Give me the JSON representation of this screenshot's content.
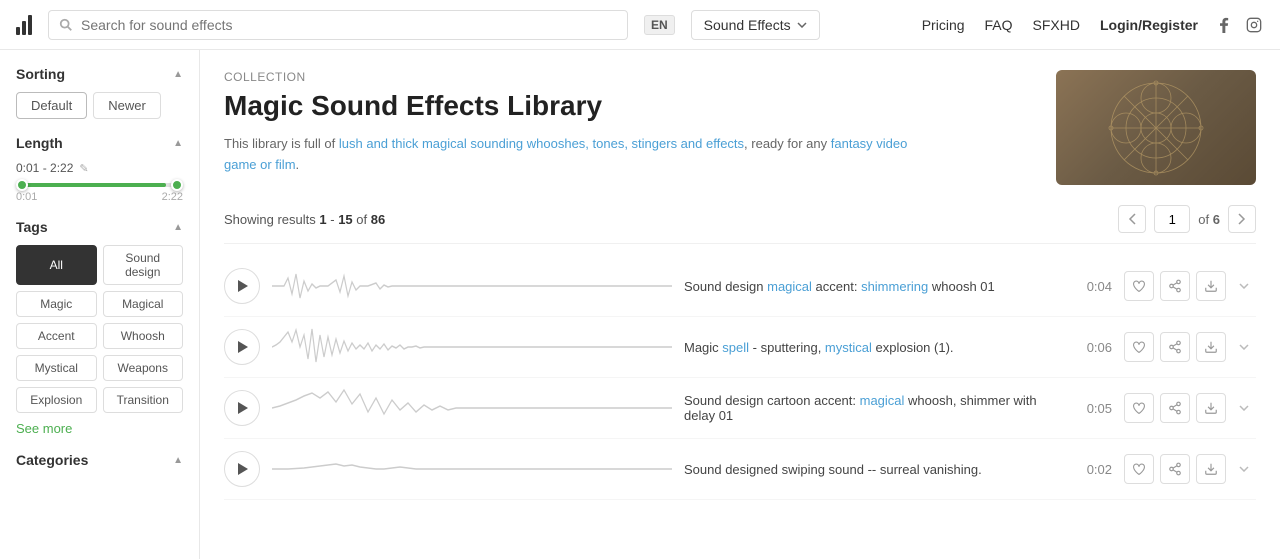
{
  "header": {
    "search_placeholder": "Search for sound effects",
    "lang": "EN",
    "sound_effects_label": "Sound Effects",
    "nav": {
      "pricing": "Pricing",
      "faq": "FAQ",
      "sfxhd": "SFXHD",
      "login": "Login/Register"
    }
  },
  "sidebar": {
    "sorting": {
      "title": "Sorting",
      "options": [
        {
          "label": "Default",
          "active": true
        },
        {
          "label": "Newer",
          "active": false
        }
      ]
    },
    "length": {
      "title": "Length",
      "range": "0:01 - 2:22",
      "min": "0:01",
      "max": "2:22"
    },
    "tags": {
      "title": "Tags",
      "items": [
        {
          "label": "All",
          "active": true
        },
        {
          "label": "Sound design",
          "active": false
        },
        {
          "label": "Magic",
          "active": false
        },
        {
          "label": "Magical",
          "active": false
        },
        {
          "label": "Accent",
          "active": false
        },
        {
          "label": "Whoosh",
          "active": false
        },
        {
          "label": "Mystical",
          "active": false
        },
        {
          "label": "Weapons",
          "active": false
        },
        {
          "label": "Explosion",
          "active": false
        },
        {
          "label": "Transition",
          "active": false
        }
      ],
      "see_more": "See more"
    },
    "categories": {
      "title": "Categories"
    }
  },
  "collection": {
    "label": "Collection",
    "title": "Magic Sound Effects Library",
    "description_parts": [
      "This library is full of ",
      "lush and thick magical sounding whooshes, tones, stingers and effects",
      ", ready for any ",
      "fantasy video game or film",
      "."
    ]
  },
  "results": {
    "showing_text": "Showing results",
    "range_start": "1",
    "range_end": "15",
    "total": "86",
    "current_page": "1",
    "total_pages": "6"
  },
  "sounds": [
    {
      "name": "Sound design ",
      "highlight1": "magical",
      "middle1": " accent: ",
      "highlight2": "shimmering",
      "end1": " whoosh 01",
      "duration": "0:04",
      "waveform_type": "sparse"
    },
    {
      "name": "Magic ",
      "highlight1": "spell",
      "middle1": " - sputtering, ",
      "highlight2": "mystical",
      "end1": " explosion (1).",
      "duration": "0:06",
      "waveform_type": "dense"
    },
    {
      "name": "Sound design cartoon accent: ",
      "highlight1": "magical",
      "middle1": " whoosh, shimmer with delay 01",
      "highlight2": "",
      "end1": "",
      "duration": "0:05",
      "waveform_type": "medium"
    },
    {
      "name": "Sound designed swiping sound -- surreal vanishing.",
      "highlight1": "",
      "middle1": "",
      "highlight2": "",
      "end1": "",
      "duration": "0:02",
      "waveform_type": "thin"
    }
  ]
}
